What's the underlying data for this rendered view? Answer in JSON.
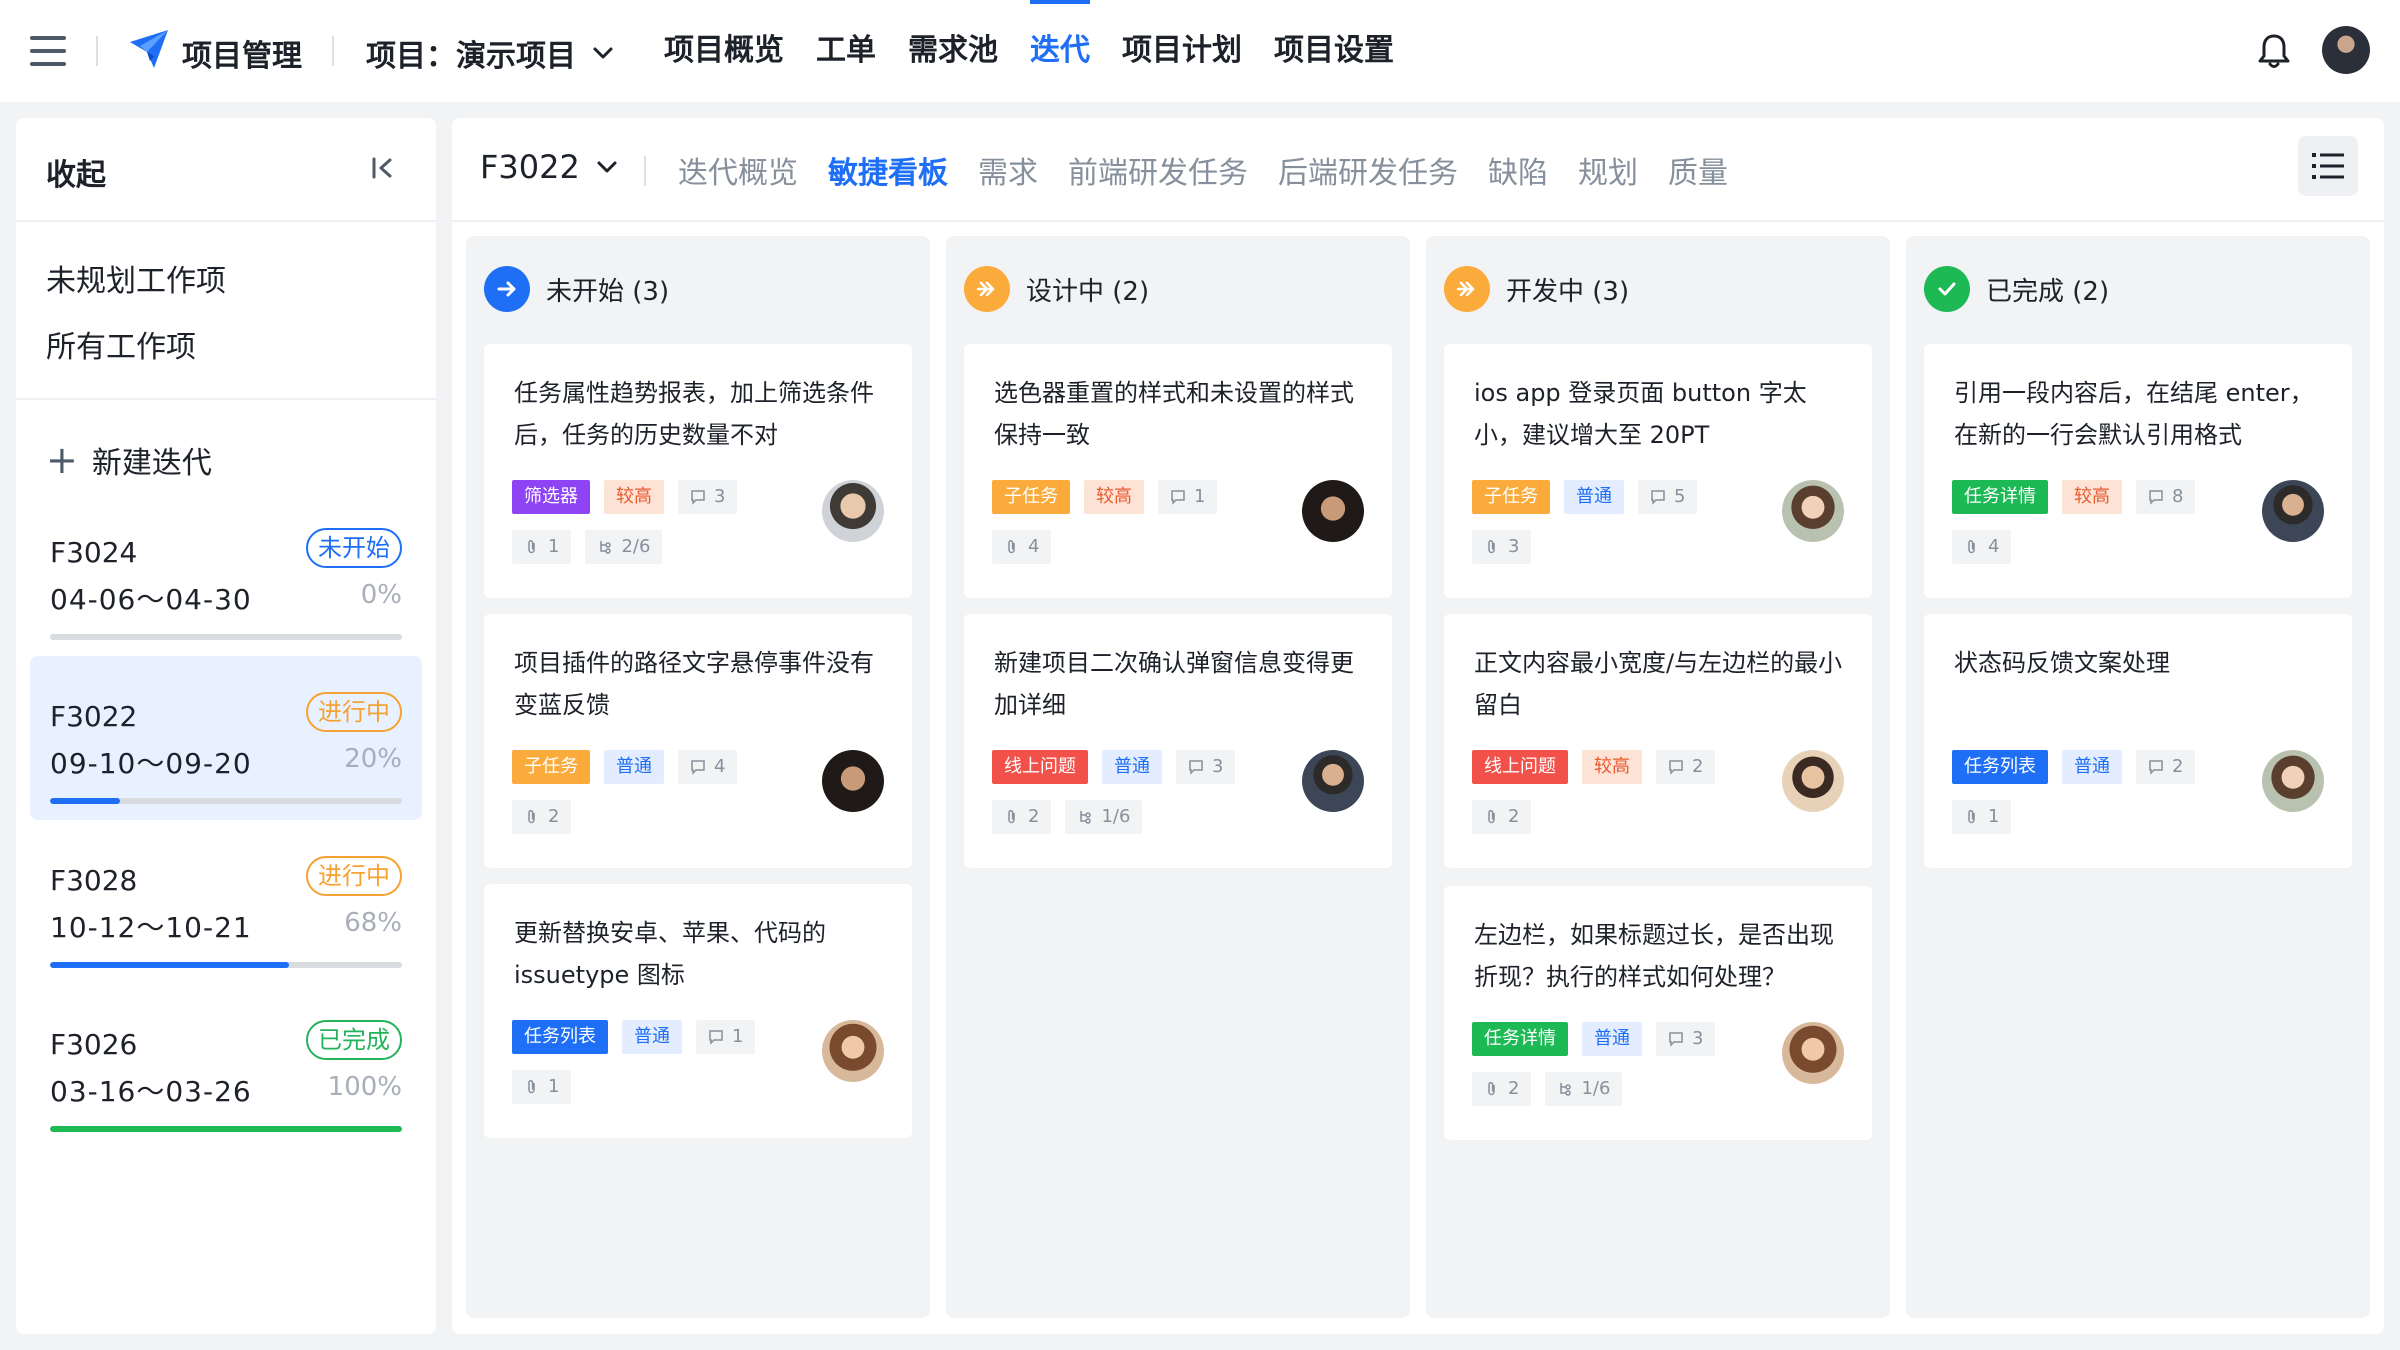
{
  "topbar": {
    "app_title": "项目管理",
    "project_select": "项目：演示项目",
    "nav": [
      {
        "label": "项目概览",
        "active": false
      },
      {
        "label": "工单",
        "active": false
      },
      {
        "label": "需求池",
        "active": false
      },
      {
        "label": "迭代",
        "active": true
      },
      {
        "label": "项目计划",
        "active": false
      },
      {
        "label": "项目设置",
        "active": false
      }
    ],
    "icons": [
      "menu-icon",
      "logo-icon",
      "chevron-down-icon",
      "bell-icon",
      "avatar"
    ]
  },
  "sidebar": {
    "collapse_label": "收起",
    "links": [
      "未规划工作项",
      "所有工作项"
    ],
    "new_iteration": "新建迭代",
    "iterations": [
      {
        "name": "F3024",
        "range": "04-06～04-30",
        "percent": "0%",
        "progress": 0,
        "status": "未开始",
        "status_color": "#1e6ff5",
        "selected": false
      },
      {
        "name": "F3022",
        "range": "09-10～09-20",
        "percent": "20%",
        "progress": 0.2,
        "status": "进行中",
        "status_color": "#f7a132",
        "selected": true
      },
      {
        "name": "F3028",
        "range": "10-12～10-21",
        "percent": "68%",
        "progress": 0.68,
        "status": "进行中",
        "status_color": "#f7a132",
        "selected": false
      },
      {
        "name": "F3026",
        "range": "03-16～03-26",
        "percent": "100%",
        "progress": 1.0,
        "status": "已完成",
        "status_color": "#23b35a",
        "selected": false
      }
    ]
  },
  "main": {
    "iteration_select": "F3022",
    "tabs": [
      {
        "label": "迭代概览",
        "active": false
      },
      {
        "label": "敏捷看板",
        "active": true
      },
      {
        "label": "需求",
        "active": false
      },
      {
        "label": "前端研发任务",
        "active": false
      },
      {
        "label": "后端研发任务",
        "active": false
      },
      {
        "label": "缺陷",
        "active": false
      },
      {
        "label": "规划",
        "active": false
      },
      {
        "label": "质量",
        "active": false
      }
    ]
  },
  "colors": {
    "accent": "#1e6ff5",
    "not_started": "#1e6ff5",
    "in_progress": "#fbab3c",
    "done": "#1db954"
  },
  "board": {
    "columns": [
      {
        "title": "未开始 (3)",
        "icon": "arrow-right-icon",
        "cards": [
          {
            "title": "任务属性趋势报表，加上筛选条件后，任务的历史数量不对",
            "type": "筛选器",
            "priority": "较高",
            "comments": "3",
            "attachments": "1",
            "subtasks": "2/6"
          },
          {
            "title": "项目插件的路径文字悬停事件没有变蓝反馈",
            "type": "子任务",
            "priority": "普通",
            "comments": "4",
            "attachments": "2",
            "subtasks": null
          },
          {
            "title": "更新替换安卓、苹果、代码的 issuetype 图标",
            "type": "任务列表",
            "priority": "普通",
            "comments": "1",
            "attachments": "1",
            "subtasks": null
          }
        ]
      },
      {
        "title": "设计中 (2)",
        "icon": "double-arrow-icon",
        "cards": [
          {
            "title": "选色器重置的样式和未设置的样式保持一致",
            "type": "子任务",
            "priority": "较高",
            "comments": "1",
            "attachments": "4",
            "subtasks": null
          },
          {
            "title": "新建项目二次确认弹窗信息变得更加详细",
            "type": "线上问题",
            "priority": "普通",
            "comments": "3",
            "attachments": "2",
            "subtasks": "1/6"
          }
        ]
      },
      {
        "title": "开发中 (3)",
        "icon": "double-arrow-icon",
        "cards": [
          {
            "title": "ios app 登录页面 button 字太小，建议增大至 20PT",
            "type": "子任务",
            "priority": "普通",
            "comments": "5",
            "attachments": "3",
            "subtasks": null
          },
          {
            "title": "正文内容最小宽度/与左边栏的最小留白",
            "type": "线上问题",
            "priority": "较高",
            "comments": "2",
            "attachments": "2",
            "subtasks": null
          },
          {
            "title": "左边栏，如果标题过长，是否出现折现？执行的样式如何处理？",
            "type": "任务详情",
            "priority": "普通",
            "comments": "3",
            "attachments": "2",
            "subtasks": "1/6"
          }
        ]
      },
      {
        "title": "已完成 (2)",
        "icon": "check-icon",
        "cards": [
          {
            "title": "引用一段内容后，在结尾 enter，在新的一行会默认引用格式",
            "type": "任务详情",
            "priority": "较高",
            "comments": "8",
            "attachments": "4",
            "subtasks": null
          },
          {
            "title": "状态码反馈文案处理",
            "type": "任务列表",
            "priority": "普通",
            "comments": "2",
            "attachments": "1",
            "subtasks": null
          }
        ]
      }
    ]
  }
}
